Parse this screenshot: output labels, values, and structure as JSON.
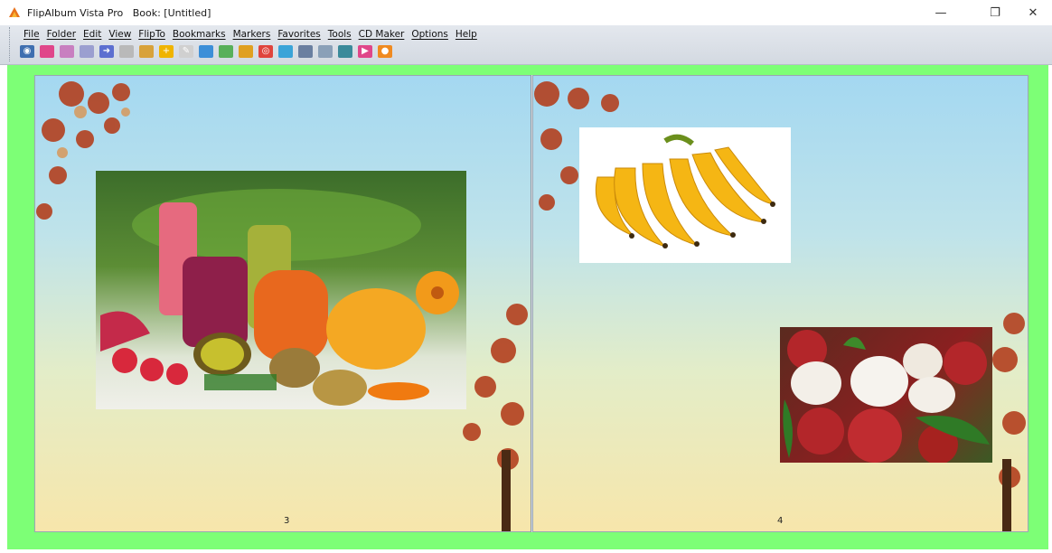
{
  "window": {
    "title": "FlipAlbum Vista Pro   Book: [Untitled]",
    "controls": {
      "minimize": "—",
      "maximize": "❐",
      "close": "✕"
    }
  },
  "menu": [
    {
      "label": "File"
    },
    {
      "label": "Folder"
    },
    {
      "label": "Edit"
    },
    {
      "label": "View"
    },
    {
      "label": "FlipTo"
    },
    {
      "label": "Bookmarks"
    },
    {
      "label": "Markers"
    },
    {
      "label": "Favorites"
    },
    {
      "label": "Tools"
    },
    {
      "label": "CD Maker"
    },
    {
      "label": "Options"
    },
    {
      "label": "Help"
    }
  ],
  "toolbar": [
    {
      "icon": "eye-icon",
      "color": "#3f6fb0",
      "glyph": "◉"
    },
    {
      "icon": "pink-book-icon",
      "color": "#e0468a",
      "glyph": ""
    },
    {
      "icon": "open-book-icon",
      "color": "#c87fc0",
      "glyph": ""
    },
    {
      "icon": "page-icon",
      "color": "#9b9fd0",
      "glyph": ""
    },
    {
      "icon": "arrow-right-icon",
      "color": "#5c6fd0",
      "glyph": "➜"
    },
    {
      "icon": "grid-icon",
      "color": "#b9b9b9",
      "glyph": ""
    },
    {
      "icon": "print-icon",
      "color": "#d8a23a",
      "glyph": ""
    },
    {
      "icon": "plus-icon",
      "color": "#f0b400",
      "glyph": "+"
    },
    {
      "icon": "pen-icon",
      "color": "#d0d0d0",
      "glyph": "✎"
    },
    {
      "icon": "two-pages-icon",
      "color": "#3d8fd8",
      "glyph": ""
    },
    {
      "icon": "tag-icon",
      "color": "#58b05a",
      "glyph": ""
    },
    {
      "icon": "album-icon",
      "color": "#e0a020",
      "glyph": ""
    },
    {
      "icon": "target-icon",
      "color": "#e0443c",
      "glyph": "◎"
    },
    {
      "icon": "window-icon",
      "color": "#3aa4d8",
      "glyph": ""
    },
    {
      "icon": "card-icon",
      "color": "#6a7fa0",
      "glyph": ""
    },
    {
      "icon": "film-icon",
      "color": "#8aa0b8",
      "glyph": ""
    },
    {
      "icon": "cd-icon",
      "color": "#3a8a9a",
      "glyph": ""
    },
    {
      "icon": "flag-icon",
      "color": "#e0468a",
      "glyph": "▶"
    },
    {
      "icon": "star-icon",
      "color": "#f08a20",
      "glyph": "●"
    }
  ],
  "album": {
    "left_page_number": "3",
    "right_page_number": "4",
    "background_color": "#7dff76"
  }
}
